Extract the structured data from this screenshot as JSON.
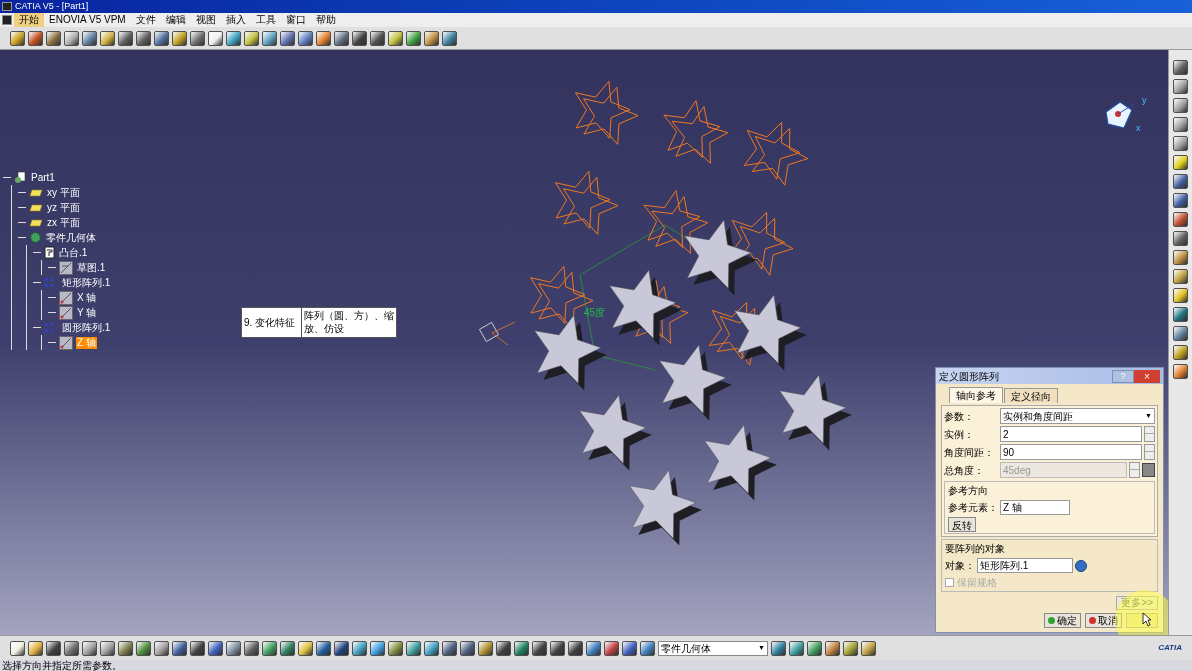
{
  "window": {
    "title": "CATIA V5 - [Part1]"
  },
  "menu": [
    {
      "label": "开始",
      "selected": true
    },
    {
      "label": "ENOVIA V5 VPM",
      "selected": false
    },
    {
      "label": "文件",
      "selected": false
    },
    {
      "label": "编辑",
      "selected": false
    },
    {
      "label": "视图",
      "selected": false
    },
    {
      "label": "插入",
      "selected": false
    },
    {
      "label": "工具",
      "selected": false
    },
    {
      "label": "窗口",
      "selected": false
    },
    {
      "label": "帮助",
      "selected": false
    }
  ],
  "tree": {
    "label": "Part1",
    "kind": "part",
    "selected": false,
    "children": [
      {
        "label": "xy 平面",
        "kind": "plane",
        "selected": false
      },
      {
        "label": "yz 平面",
        "kind": "plane",
        "selected": false
      },
      {
        "label": "zx 平面",
        "kind": "plane",
        "selected": false
      },
      {
        "label": "零件几何体",
        "kind": "body",
        "selected": false,
        "children": [
          {
            "label": "凸台.1",
            "kind": "pad",
            "selected": false,
            "children": [
              {
                "label": "草图.1",
                "kind": "sketch",
                "selected": false
              }
            ]
          },
          {
            "label": "矩形阵列.1",
            "kind": "pattern",
            "selected": false,
            "children": [
              {
                "label": "X 轴",
                "kind": "axis",
                "selected": false
              },
              {
                "label": "Y 轴",
                "kind": "axis",
                "selected": false
              }
            ]
          },
          {
            "label": "圆形阵列.1",
            "kind": "pattern",
            "selected": false,
            "children": [
              {
                "label": "Z 轴",
                "kind": "axis",
                "selected": true
              }
            ]
          }
        ]
      }
    ]
  },
  "note": {
    "number": "9. 变化特征",
    "text": "阵列（圆、方）、缩放、仿设"
  },
  "canvas": {
    "angle_label": "45度",
    "compass_y": "y",
    "compass_x": "x"
  },
  "dialog": {
    "title": "定义圆形阵列",
    "help": "?",
    "close": "×",
    "tabs": [
      {
        "label": "轴向参考",
        "selected": true
      },
      {
        "label": "定义径向",
        "selected": false
      }
    ],
    "parameters": {
      "label": "参数：",
      "value": "实例和角度间距",
      "caret": "▼"
    },
    "instances": {
      "label": "实例：",
      "value": "2"
    },
    "spacing": {
      "label": "角度间距：",
      "value": "90"
    },
    "total": {
      "label": "总角度：",
      "value": "45deg",
      "disabled": true
    },
    "direction": {
      "title": "参考方向",
      "label": "参考元素：",
      "value": "Z 轴",
      "button": "反转"
    },
    "object": {
      "title": "要阵列的对象",
      "label": "对象：",
      "value": "矩形阵列.1",
      "keep_spec": {
        "label": "保留规格",
        "checked": false,
        "disabled": true
      }
    },
    "more": "更多>>",
    "ok": "确定",
    "cancel": "取消"
  },
  "body_select": {
    "value": "零件几何体",
    "caret": "▼"
  },
  "logo": "CATIA",
  "status_bar": "选择方向并指定所需参数。"
}
